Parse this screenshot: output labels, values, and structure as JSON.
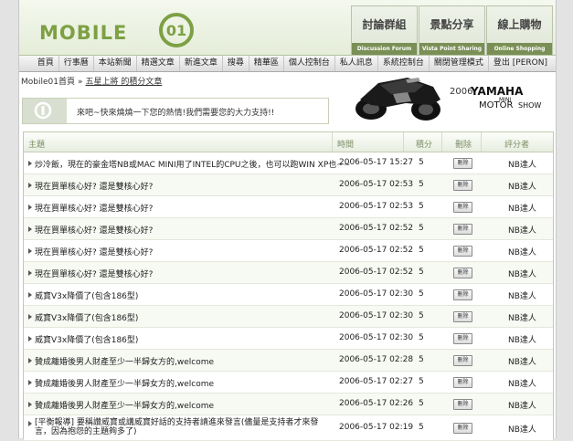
{
  "header": {
    "logo_text": "MOBILE",
    "logo_badge": "01",
    "tabs": [
      {
        "zh": "討論群組",
        "en": "Discussion Forum"
      },
      {
        "zh": "景點分享",
        "en": "Vista Point Sharing"
      },
      {
        "zh": "線上購物",
        "en": "Online Shopping"
      }
    ]
  },
  "menu": [
    "首頁",
    "行事曆",
    "本站新聞",
    "精選文章",
    "新進文章",
    "搜尋",
    "精華區",
    "個人控制台",
    "私人訊息",
    "系統控制台",
    "關閉管理模式",
    "登出 [PERON]"
  ],
  "breadcrumb": {
    "home": "Mobile01首頁",
    "sep": "»",
    "current": "五星上將 的積分文章"
  },
  "notice": {
    "text": "來吧~快來燒燒一下您的熱情!我們需要您的大力支持!!"
  },
  "ad": {
    "year": "2006",
    "brand": "YAMAHA",
    "mini": "MINI",
    "motor": "MOTOR",
    "show": "SHOW"
  },
  "table": {
    "headers": {
      "subject": "主題",
      "time": "時間",
      "score": "積分",
      "delete": "刪除",
      "rater": "評分者"
    },
    "delete_label": "刪除",
    "rows": [
      {
        "subject": "炒冷飯，現在的豪金塔NB或MAC MINI用了INTEL的CPU之後，也可以跑WIN XP也~~",
        "time": "2006-05-17 15:27",
        "score": "5",
        "rater": "NB達人"
      },
      {
        "subject": "現在買單核心好? 還是雙核心好?",
        "time": "2006-05-17 02:53",
        "score": "5",
        "rater": "NB達人"
      },
      {
        "subject": "現在買單核心好? 還是雙核心好?",
        "time": "2006-05-17 02:53",
        "score": "5",
        "rater": "NB達人"
      },
      {
        "subject": "現在買單核心好? 還是雙核心好?",
        "time": "2006-05-17 02:52",
        "score": "5",
        "rater": "NB達人"
      },
      {
        "subject": "現在買單核心好? 還是雙核心好?",
        "time": "2006-05-17 02:52",
        "score": "5",
        "rater": "NB達人"
      },
      {
        "subject": "現在買單核心好? 還是雙核心好?",
        "time": "2006-05-17 02:52",
        "score": "5",
        "rater": "NB達人"
      },
      {
        "subject": "威寶V3x降價了(包含186型)",
        "time": "2006-05-17 02:30",
        "score": "5",
        "rater": "NB達人"
      },
      {
        "subject": "威寶V3x降價了(包含186型)",
        "time": "2006-05-17 02:30",
        "score": "5",
        "rater": "NB達人"
      },
      {
        "subject": "威寶V3x降價了(包含186型)",
        "time": "2006-05-17 02:30",
        "score": "5",
        "rater": "NB達人"
      },
      {
        "subject": "贊成離婚後男人財產至少一半歸女方的,welcome",
        "time": "2006-05-17 02:28",
        "score": "5",
        "rater": "NB達人"
      },
      {
        "subject": "贊成離婚後男人財產至少一半歸女方的,welcome",
        "time": "2006-05-17 02:27",
        "score": "5",
        "rater": "NB達人"
      },
      {
        "subject": "贊成離婚後男人財產至少一半歸女方的,welcome",
        "time": "2006-05-17 02:26",
        "score": "5",
        "rater": "NB達人"
      },
      {
        "subject": "[平衡報導] 要稱讚威寶或講威寶好話的支持者請進來發言(儘量是支持者才來發言，因為抱怨的主題夠多了)",
        "time": "2006-05-17 02:19",
        "score": "5",
        "rater": "NB達人"
      }
    ]
  }
}
